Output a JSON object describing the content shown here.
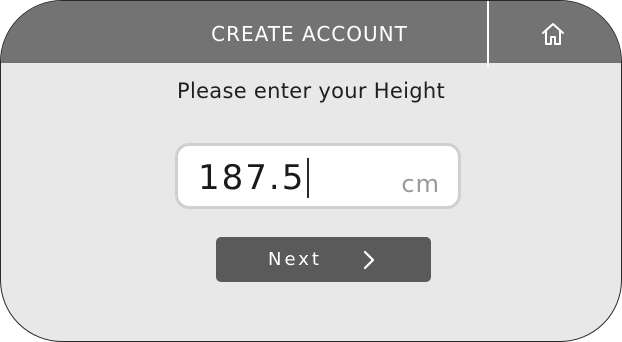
{
  "header": {
    "title": "CREATE ACCOUNT",
    "home_icon": "home-icon"
  },
  "prompt": "Please enter your Height",
  "height_field": {
    "value": "187.5",
    "unit": "cm"
  },
  "next_button": {
    "label": "Next",
    "icon": "chevron-right-icon"
  },
  "colors": {
    "header": "#737373",
    "background": "#e8e8e8",
    "button": "#5a5a5a",
    "field_border": "#cfcfcf"
  }
}
